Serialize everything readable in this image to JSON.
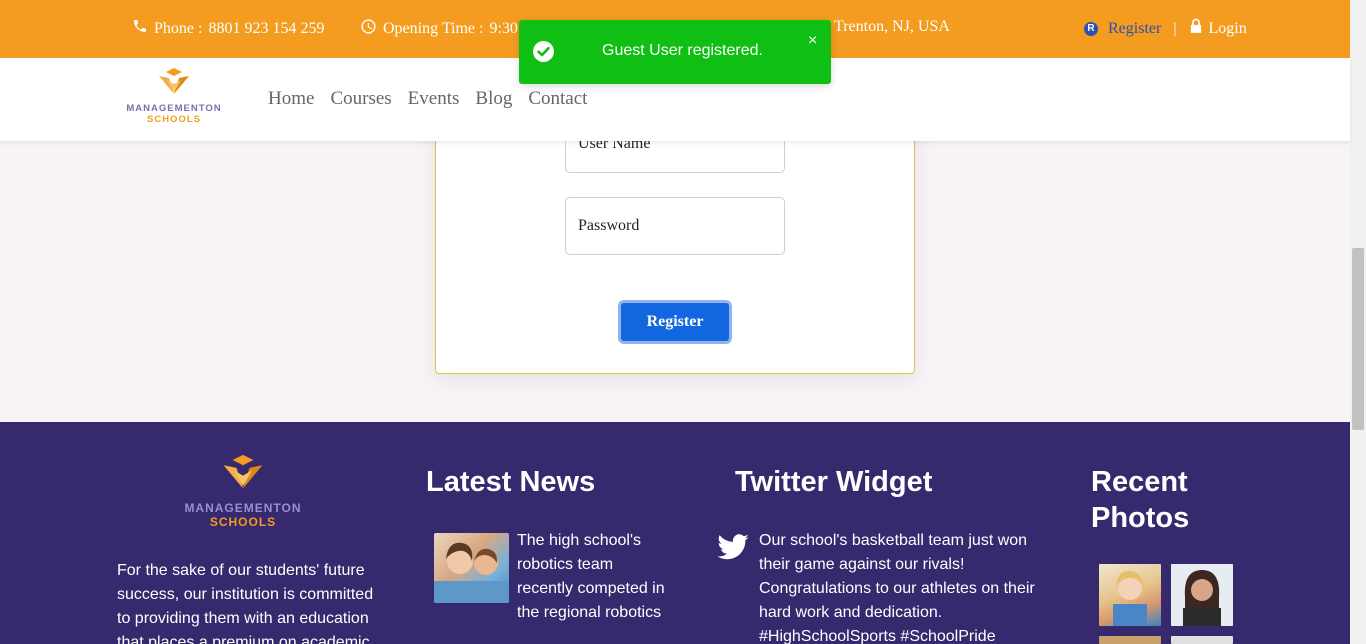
{
  "topbar": {
    "phone_label": "Phone :",
    "phone_value": "8801 923 154 259",
    "opening_label": "Opening Time :",
    "opening_value": "9:30",
    "address": "Trenton, NJ, USA",
    "register_label": "Register",
    "separator": "|",
    "login_label": "Login",
    "bg_color": "#f39c1f"
  },
  "brand": {
    "line1": "MANAGEMENTON",
    "line2": "SCHOOLS"
  },
  "nav": {
    "items": [
      {
        "label": "Home"
      },
      {
        "label": "Courses"
      },
      {
        "label": "Events"
      },
      {
        "label": "Blog"
      },
      {
        "label": "Contact"
      }
    ]
  },
  "form": {
    "username_placeholder": "User Name",
    "password_placeholder": "Password",
    "submit_label": "Register"
  },
  "toast": {
    "message": "Guest User registered.",
    "close_glyph": "×",
    "color": "#0fbf14"
  },
  "footer": {
    "about_text": "For the sake of our students' future success, our institution is committed to providing them with an education that places a premium on academic",
    "news_heading": "Latest News",
    "news_item_text": "The high school's robotics team recently competed in the regional robotics",
    "twitter_heading": "Twitter Widget",
    "tweet_text": "Our school's basketball team just won their game against our rivals! Congratulations to our athletes on their hard work and dedication. #HighSchoolSports #SchoolPride",
    "photos_heading": "Recent Photos",
    "bg_color": "#36296e"
  }
}
